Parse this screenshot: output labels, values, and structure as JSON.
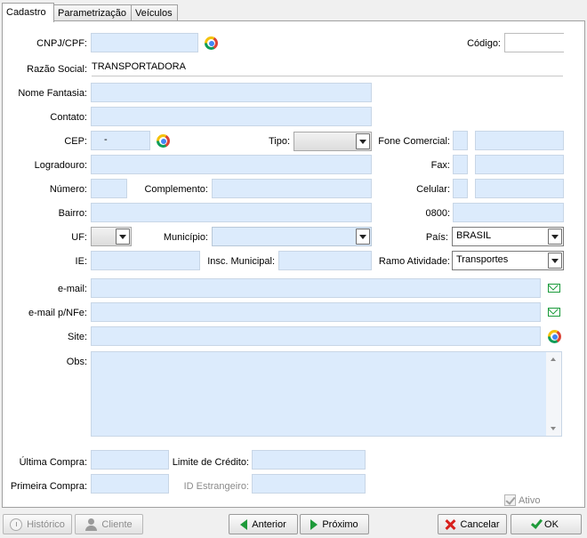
{
  "tabs": [
    "Cadastro",
    "Parametrização",
    "Veículos"
  ],
  "labels": {
    "cnpj": "CNPJ/CPF:",
    "codigo": "Código:",
    "razao": "Razão Social:",
    "fantasia": "Nome Fantasia:",
    "contato": "Contato:",
    "cep": "CEP:",
    "tipo": "Tipo:",
    "fone": "Fone Comercial:",
    "logradouro": "Logradouro:",
    "fax": "Fax:",
    "numero": "Número:",
    "complemento": "Complemento:",
    "celular": "Celular:",
    "bairro": "Bairro:",
    "n0800": "0800:",
    "uf": "UF:",
    "municipio": "Município:",
    "pais": "País:",
    "ie": "IE:",
    "inscmun": "Insc. Municipal:",
    "ramo": "Ramo Atividade:",
    "email": "e-mail:",
    "emailnfe": "e-mail p/NFe:",
    "site": "Site:",
    "obs": "Obs:",
    "ultima": "Última Compra:",
    "limite": "Limite de Crédito:",
    "primeira": "Primeira Compra:",
    "idestr": "ID Estrangeiro:",
    "ativo": "Ativo"
  },
  "values": {
    "razao": "TRANSPORTADORA",
    "cep": "-",
    "pais": "BRASIL",
    "ramo": "Transportes"
  },
  "buttons": {
    "historico": "Histórico",
    "cliente": "Cliente",
    "anterior": "Anterior",
    "proximo": "Próximo",
    "cancelar": "Cancelar",
    "ok": "OK"
  }
}
